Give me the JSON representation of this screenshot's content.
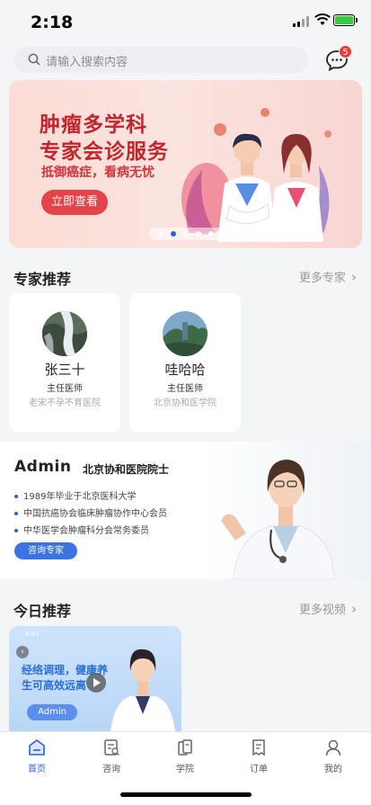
{
  "status_bar": {
    "time": "2:18"
  },
  "search": {
    "placeholder": "请输入搜索内容"
  },
  "messages": {
    "badge_count": "5"
  },
  "banner": {
    "title_line1": "肿瘤多学科",
    "title_line2": "专家会诊服务",
    "subtitle": "抵御癌症，看病无忧",
    "button": "立即查看",
    "dots_total": 5,
    "dots_active_index": 1
  },
  "experts": {
    "title": "专家推荐",
    "more": "更多专家",
    "items": [
      {
        "name": "张三十",
        "title": "主任医师",
        "hospital": "老宋不孕不育医院"
      },
      {
        "name": "哇哈哈",
        "title": "主任医师",
        "hospital": "北京协和医学院"
      }
    ]
  },
  "featured": {
    "name": "Admin",
    "org": "北京协和医院院士",
    "bullets": [
      "1989年毕业于北京医科大学",
      "中国抗癌协会临床肿瘤协作中心会员",
      "中华医学会肿瘤科分会常务委员"
    ],
    "button": "咨询专家"
  },
  "today": {
    "title": "今日推荐",
    "more": "更多视频",
    "video": {
      "status_time": "9:41",
      "line1": "经络调理，健康养",
      "line2": "生可高效远离",
      "tag": "Admin"
    }
  },
  "tabs": [
    {
      "label": "首页",
      "icon": "home-icon",
      "active": true
    },
    {
      "label": "咨询",
      "icon": "consult-icon",
      "active": false
    },
    {
      "label": "学院",
      "icon": "academy-icon",
      "active": false
    },
    {
      "label": "订单",
      "icon": "order-icon",
      "active": false
    },
    {
      "label": "我的",
      "icon": "profile-icon",
      "active": false
    }
  ],
  "colors": {
    "accent": "#2b62d6",
    "banner_red": "#c4252c",
    "badge": "#ea3b34"
  }
}
